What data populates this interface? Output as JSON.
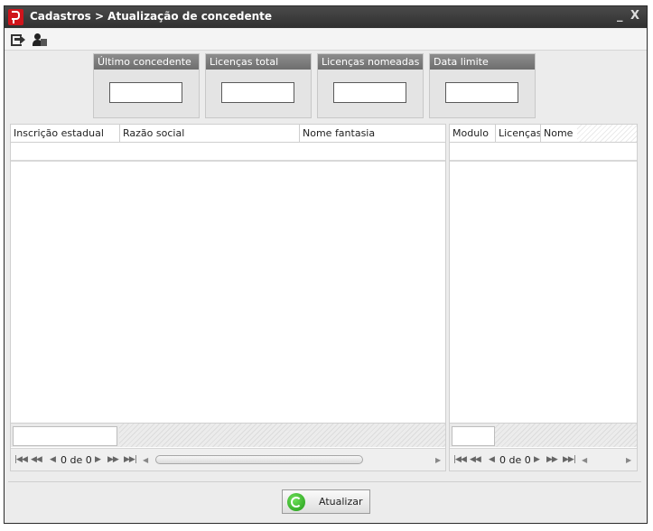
{
  "window": {
    "title": "Cadastros > Atualização de concedente",
    "minimize": "_",
    "close": "X"
  },
  "toolbar": {
    "icons": [
      "exit-icon",
      "user-icon"
    ]
  },
  "stats": [
    {
      "label": "Último concedente",
      "value": ""
    },
    {
      "label": "Licenças total",
      "value": ""
    },
    {
      "label": "Licenças nomeadas",
      "value": ""
    },
    {
      "label": "Data limite",
      "value": ""
    }
  ],
  "left_grid": {
    "columns": [
      "Inscrição estadual",
      "Razão social",
      "Nome fantasia"
    ],
    "rows": [],
    "navigator": {
      "count": "0 de 0"
    }
  },
  "right_grid": {
    "columns": [
      "Modulo",
      "Licenças",
      "Nome"
    ],
    "rows": [],
    "navigator": {
      "count": "0 de 0"
    }
  },
  "actions": {
    "update_label": "Atualizar"
  },
  "colors": {
    "titlebar": "#303030",
    "accent": "#d0141b",
    "panel_header": "#7a7a7a"
  }
}
